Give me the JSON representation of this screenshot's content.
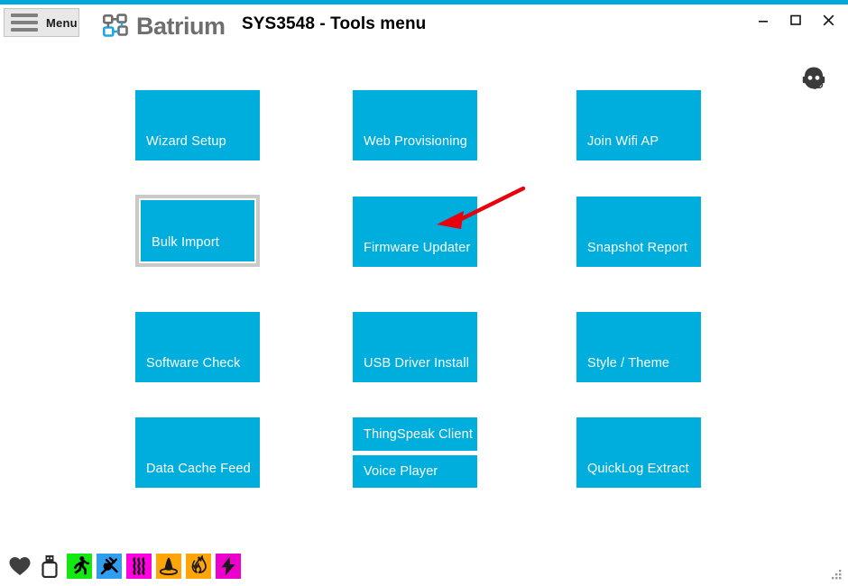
{
  "window": {
    "app_name": "Batrium",
    "title": "SYS3548 - Tools menu",
    "menu_label": "Menu",
    "accent_color": "#00a8dc",
    "tile_color": "#00aedd",
    "selected_border_color": "#c9c9c9",
    "arrow_color": "#e8000d",
    "controls": {
      "minimize": "–",
      "maximize": "☐",
      "close": "✕"
    },
    "support_icon": "headset-support-icon"
  },
  "tools": {
    "columns": [
      {
        "column": 1,
        "tiles": [
          {
            "label": "Wizard Setup",
            "name": "wizard-setup",
            "selected": false,
            "size": "large"
          },
          {
            "label": "Bulk Import",
            "name": "bulk-import",
            "selected": true,
            "size": "large"
          },
          {
            "label": "Software Check",
            "name": "software-check",
            "selected": false,
            "size": "large"
          },
          {
            "label": "Data Cache Feed",
            "name": "data-cache-feed",
            "selected": false,
            "size": "large"
          }
        ]
      },
      {
        "column": 2,
        "tiles": [
          {
            "label": "Web Provisioning",
            "name": "web-provisioning",
            "selected": false,
            "size": "large"
          },
          {
            "label": "Firmware Updater",
            "name": "firmware-updater",
            "selected": false,
            "size": "large"
          },
          {
            "label": "USB Driver Install",
            "name": "usb-driver-install",
            "selected": false,
            "size": "large"
          },
          {
            "label": "ThingSpeak Client",
            "name": "thingspeak-client",
            "selected": false,
            "size": "small"
          },
          {
            "label": "Voice Player",
            "name": "voice-player",
            "selected": false,
            "size": "small"
          }
        ]
      },
      {
        "column": 3,
        "tiles": [
          {
            "label": "Join Wifi  AP",
            "name": "join-wifi-ap",
            "selected": false,
            "size": "large"
          },
          {
            "label": "Snapshot Report",
            "name": "snapshot-report",
            "selected": false,
            "size": "large"
          },
          {
            "label": "Style / Theme",
            "name": "style-theme",
            "selected": false,
            "size": "large"
          },
          {
            "label": "QuickLog Extract",
            "name": "quicklog-extract",
            "selected": false,
            "size": "large"
          }
        ]
      }
    ]
  },
  "statusbar": {
    "icons": [
      {
        "name": "heart-icon",
        "glyph": "heart",
        "fg": "#3f3f3f",
        "bg": "transparent"
      },
      {
        "name": "usb-drive-icon",
        "glyph": "usb",
        "fg": "#2b2b2b",
        "bg": "transparent"
      },
      {
        "name": "running-person-icon",
        "glyph": "runner",
        "fg": "#000000",
        "bg": "#13e813"
      },
      {
        "name": "power-plug-icon",
        "glyph": "plug",
        "fg": "#000000",
        "bg": "#2f9ef0"
      },
      {
        "name": "heat-waves-icon",
        "glyph": "waves",
        "fg": "#000000",
        "bg": "#ff00e0"
      },
      {
        "name": "bell-alarm-icon",
        "glyph": "bell",
        "fg": "#000000",
        "bg": "#ffa50a"
      },
      {
        "name": "flame-icon",
        "glyph": "flame",
        "fg": "#000000",
        "bg": "#ffa50a"
      },
      {
        "name": "lightning-bolt-icon",
        "glyph": "bolt",
        "fg": "#000000",
        "bg": "#ee00cc"
      }
    ],
    "resize_grip": "resize-grip"
  }
}
